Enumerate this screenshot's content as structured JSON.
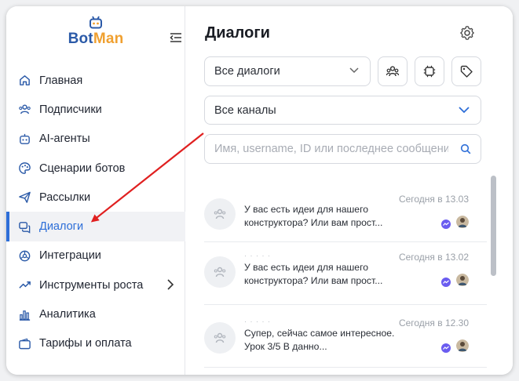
{
  "brand": {
    "part1": "Bot",
    "part2": "Man"
  },
  "sidebar": {
    "items": [
      {
        "label": "Главная",
        "icon": "home-icon"
      },
      {
        "label": "Подписчики",
        "icon": "users-icon"
      },
      {
        "label": "AI-агенты",
        "icon": "robot-icon"
      },
      {
        "label": "Сценарии ботов",
        "icon": "palette-icon"
      },
      {
        "label": "Рассылки",
        "icon": "paper-plane-icon"
      },
      {
        "label": "Диалоги",
        "icon": "chat-icon",
        "active": true
      },
      {
        "label": "Интеграции",
        "icon": "integrations-icon"
      },
      {
        "label": "Инструменты роста",
        "icon": "trend-up-icon",
        "has_submenu": true
      },
      {
        "label": "Аналитика",
        "icon": "bar-chart-icon"
      },
      {
        "label": "Тарифы и оплата",
        "icon": "wallet-icon"
      }
    ]
  },
  "main": {
    "title": "Диалоги",
    "filter_dialogs": "Все диалоги",
    "filter_channels": "Все каналы",
    "search_placeholder": "Имя, username, ID или последнее сообщение"
  },
  "dialogs": [
    {
      "name": "",
      "message": "У вас есть идеи для нашего конструктора? Или вам прост...",
      "time": "Сегодня в 13.03"
    },
    {
      "name": "·  ·  ·  ·  ·",
      "message": "У вас есть идеи для нашего конструктора? Или вам прост...",
      "time": "Сегодня в 13.02"
    },
    {
      "name": "·  ·  ·  ·  ·",
      "message": "Супер, сейчас самое интересное. Урок 3/5 В данно...",
      "time": "Сегодня в 12.30"
    }
  ],
  "colors": {
    "accent": "#2d6ed8",
    "brand_blue": "#2b5aa8",
    "brand_orange": "#f0a030",
    "annotation_arrow": "#e02020",
    "messenger": "#6a5cf0"
  }
}
